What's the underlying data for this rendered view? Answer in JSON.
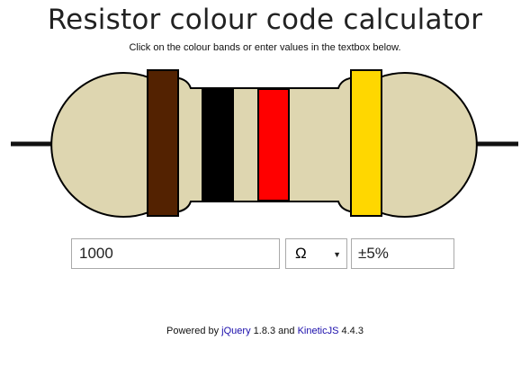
{
  "header": {
    "title": "Resistor colour code calculator",
    "subtitle": "Click on the colour bands or enter values in the textbox below."
  },
  "resistor": {
    "body_color": "#ded6b0",
    "lead_color": "#111111",
    "bands": [
      {
        "name": "band-1",
        "color": "#532201",
        "color_name": "brown"
      },
      {
        "name": "band-2",
        "color": "#000000",
        "color_name": "black"
      },
      {
        "name": "band-3",
        "color": "#ff0000",
        "color_name": "red"
      },
      {
        "name": "band-tolerance",
        "color": "#ffd700",
        "color_name": "gold"
      }
    ]
  },
  "controls": {
    "value": "1000",
    "unit": "Ω",
    "unit_caret": "▼",
    "tolerance": "±5%"
  },
  "footer": {
    "powered_by": "Powered by",
    "jquery_label": "jQuery",
    "jquery_version": "1.8.3 and",
    "kinetic_label": "KineticJS",
    "kinetic_version": "4.4.3"
  }
}
